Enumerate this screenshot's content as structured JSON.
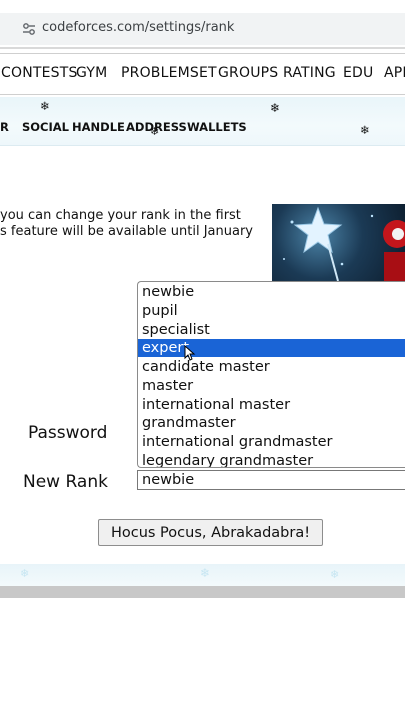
{
  "browser": {
    "url": "codeforces.com/settings/rank"
  },
  "main_nav": [
    "CONTESTS",
    "GYM",
    "PROBLEMSET",
    "GROUPS",
    "RATING",
    "EDU",
    "API"
  ],
  "sub_nav": [
    "R",
    "SOCIAL",
    "HANDLE",
    "ADDRESS",
    "WALLETS"
  ],
  "info": {
    "line1": "you can change your rank in the first",
    "line2": "s feature will be available until January"
  },
  "form": {
    "password_label": "Password",
    "new_rank_label": "New Rank",
    "selected_rank": "newbie",
    "highlighted_option": "expert",
    "options": [
      "newbie",
      "pupil",
      "specialist",
      "expert",
      "candidate master",
      "master",
      "international master",
      "grandmaster",
      "international grandmaster",
      "legendary grandmaster"
    ],
    "submit_label": "Hocus Pocus, Abrakadabra!"
  },
  "colors": {
    "highlight": "#1a64d6",
    "snow_band": "#e9f5fa"
  }
}
